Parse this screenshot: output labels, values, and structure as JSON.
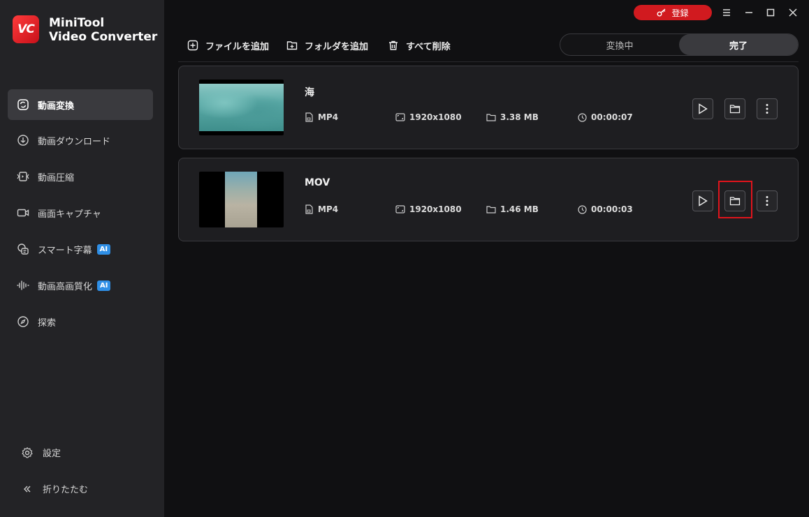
{
  "app": {
    "brand_line1": "MiniTool",
    "brand_line2": "Video Converter",
    "logo_text": "VC",
    "accent": "#d11a1f"
  },
  "titlebar": {
    "register_label": "登録"
  },
  "sidebar": {
    "items": [
      {
        "label": "動画変換",
        "icon": "convert-icon",
        "active": true
      },
      {
        "label": "動画ダウンロード",
        "icon": "download-icon"
      },
      {
        "label": "動画圧縮",
        "icon": "compress-icon"
      },
      {
        "label": "画面キャプチャ",
        "icon": "camera-icon"
      },
      {
        "label": "スマート字幕",
        "icon": "subtitle-icon",
        "badge": "AI"
      },
      {
        "label": "動画高画質化",
        "icon": "waveform-icon",
        "badge": "AI"
      },
      {
        "label": "探索",
        "icon": "compass-icon"
      }
    ],
    "settings_label": "設定",
    "collapse_label": "折りたたむ"
  },
  "toolbar": {
    "add_file": "ファイルを追加",
    "add_folder": "フォルダを追加",
    "delete_all": "すべて削除",
    "tab_converting": "変換中",
    "tab_done": "完了"
  },
  "files": [
    {
      "name": "海",
      "format": "MP4",
      "resolution": "1920x1080",
      "size": "3.38 MB",
      "duration": "00:00:07"
    },
    {
      "name": "MOV",
      "format": "MP4",
      "resolution": "1920x1080",
      "size": "1.46 MB",
      "duration": "00:00:03"
    }
  ]
}
